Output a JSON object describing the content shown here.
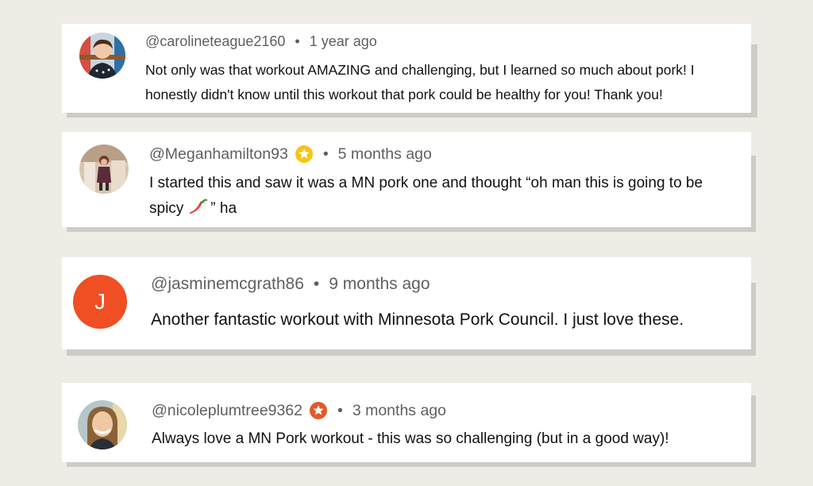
{
  "colors": {
    "background": "#efece6",
    "card": "#ffffff",
    "shadow": "#cfcbc5",
    "meta_text": "#5f5f5f",
    "body_text": "#111111",
    "avatar_j": "#f04e23",
    "badge_yellow": "#f5c518",
    "badge_orange": "#e05a2b"
  },
  "comments": [
    {
      "username": "@carolineteague2160",
      "separator": "•",
      "time": "1 year ago",
      "text": "Not only was that workout AMAZING and challenging, but I learned so much about pork! I honestly didn't know until this workout that pork could be healthy for you! Thank you!",
      "avatar": "photo"
    },
    {
      "username": "@Meganhamilton93",
      "badge": "star-badge-icon",
      "separator": "•",
      "time": "5 months ago",
      "text_before": "I started this and saw it was a MN pork one and thought “oh man this is going to be spicy",
      "emoji": "chili-pepper-icon",
      "text_after": "” ha",
      "avatar": "photo"
    },
    {
      "username": "@jasminemcgrath86",
      "separator": "•",
      "time": "9 months ago",
      "text": "Another fantastic workout with Minnesota Pork Council. I just love these.",
      "avatar_letter": "J"
    },
    {
      "username": "@nicoleplumtree9362",
      "badge": "star-badge-icon",
      "separator": "•",
      "time": "3 months ago",
      "text": "Always love a MN Pork workout - this was so challenging (but in a good way)!",
      "avatar": "photo"
    }
  ]
}
